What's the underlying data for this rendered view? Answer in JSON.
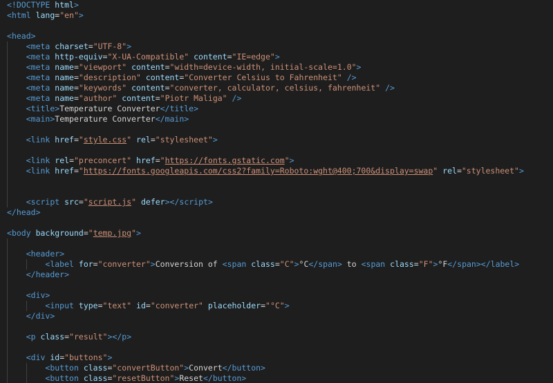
{
  "colors": {
    "background": "#1e1e1e",
    "tag": "#569cd6",
    "attribute": "#9cdcfe",
    "string": "#ce9178",
    "text": "#d4d4d4",
    "punctuation": "#808080"
  },
  "lines": [
    {
      "indent": 0,
      "tokens": [
        [
          "punct",
          "<!"
        ],
        [
          "tag",
          "DOCTYPE"
        ],
        [
          "text",
          " "
        ],
        [
          "attr",
          "html"
        ],
        [
          "punct",
          ">"
        ]
      ]
    },
    {
      "indent": 0,
      "tokens": [
        [
          "punct",
          "<"
        ],
        [
          "tag",
          "html"
        ],
        [
          "text",
          " "
        ],
        [
          "attr",
          "lang"
        ],
        [
          "text",
          "="
        ],
        [
          "str",
          "\"en\""
        ],
        [
          "punct",
          ">"
        ]
      ]
    },
    {
      "indent": 0,
      "tokens": []
    },
    {
      "indent": 0,
      "tokens": [
        [
          "punct",
          "<"
        ],
        [
          "tag",
          "head"
        ],
        [
          "punct",
          ">"
        ]
      ]
    },
    {
      "indent": 1,
      "tokens": [
        [
          "punct",
          "<"
        ],
        [
          "tag",
          "meta"
        ],
        [
          "text",
          " "
        ],
        [
          "attr",
          "charset"
        ],
        [
          "text",
          "="
        ],
        [
          "str",
          "\"UTF-8\""
        ],
        [
          "punct",
          ">"
        ]
      ]
    },
    {
      "indent": 1,
      "tokens": [
        [
          "punct",
          "<"
        ],
        [
          "tag",
          "meta"
        ],
        [
          "text",
          " "
        ],
        [
          "attr",
          "http-equiv"
        ],
        [
          "text",
          "="
        ],
        [
          "str",
          "\"X-UA-Compatible\""
        ],
        [
          "text",
          " "
        ],
        [
          "attr",
          "content"
        ],
        [
          "text",
          "="
        ],
        [
          "str",
          "\"IE=edge\""
        ],
        [
          "punct",
          ">"
        ]
      ]
    },
    {
      "indent": 1,
      "tokens": [
        [
          "punct",
          "<"
        ],
        [
          "tag",
          "meta"
        ],
        [
          "text",
          " "
        ],
        [
          "attr",
          "name"
        ],
        [
          "text",
          "="
        ],
        [
          "str",
          "\"viewport\""
        ],
        [
          "text",
          " "
        ],
        [
          "attr",
          "content"
        ],
        [
          "text",
          "="
        ],
        [
          "str",
          "\"width=device-width, initial-scale=1.0\""
        ],
        [
          "punct",
          ">"
        ]
      ]
    },
    {
      "indent": 1,
      "tokens": [
        [
          "punct",
          "<"
        ],
        [
          "tag",
          "meta"
        ],
        [
          "text",
          " "
        ],
        [
          "attr",
          "name"
        ],
        [
          "text",
          "="
        ],
        [
          "str",
          "\"description\""
        ],
        [
          "text",
          " "
        ],
        [
          "attr",
          "content"
        ],
        [
          "text",
          "="
        ],
        [
          "str",
          "\"Converter Celsius to Fahrenheit\""
        ],
        [
          "text",
          " "
        ],
        [
          "punct",
          "/>"
        ]
      ]
    },
    {
      "indent": 1,
      "tokens": [
        [
          "punct",
          "<"
        ],
        [
          "tag",
          "meta"
        ],
        [
          "text",
          " "
        ],
        [
          "attr",
          "name"
        ],
        [
          "text",
          "="
        ],
        [
          "str",
          "\"keywords\""
        ],
        [
          "text",
          " "
        ],
        [
          "attr",
          "content"
        ],
        [
          "text",
          "="
        ],
        [
          "str",
          "\"converter, calculator, celsius, fahrenheit\""
        ],
        [
          "text",
          " "
        ],
        [
          "punct",
          "/>"
        ]
      ]
    },
    {
      "indent": 1,
      "tokens": [
        [
          "punct",
          "<"
        ],
        [
          "tag",
          "meta"
        ],
        [
          "text",
          " "
        ],
        [
          "attr",
          "name"
        ],
        [
          "text",
          "="
        ],
        [
          "str",
          "\"author\""
        ],
        [
          "text",
          " "
        ],
        [
          "attr",
          "content"
        ],
        [
          "text",
          "="
        ],
        [
          "str",
          "\"Piotr Maliga\""
        ],
        [
          "text",
          " "
        ],
        [
          "punct",
          "/>"
        ]
      ]
    },
    {
      "indent": 1,
      "tokens": [
        [
          "punct",
          "<"
        ],
        [
          "tag",
          "title"
        ],
        [
          "punct",
          ">"
        ],
        [
          "text",
          "Temperature Converter"
        ],
        [
          "punct",
          "</"
        ],
        [
          "tag",
          "title"
        ],
        [
          "punct",
          ">"
        ]
      ]
    },
    {
      "indent": 1,
      "tokens": [
        [
          "punct",
          "<"
        ],
        [
          "tag",
          "main"
        ],
        [
          "punct",
          ">"
        ],
        [
          "text",
          "Temperature Converter"
        ],
        [
          "punct",
          "</"
        ],
        [
          "tag",
          "main"
        ],
        [
          "punct",
          ">"
        ]
      ]
    },
    {
      "indent": 1,
      "tokens": []
    },
    {
      "indent": 1,
      "tokens": [
        [
          "punct",
          "<"
        ],
        [
          "tag",
          "link"
        ],
        [
          "text",
          " "
        ],
        [
          "attr",
          "href"
        ],
        [
          "text",
          "="
        ],
        [
          "str",
          "\""
        ],
        [
          "link",
          "style.css"
        ],
        [
          "str",
          "\""
        ],
        [
          "text",
          " "
        ],
        [
          "attr",
          "rel"
        ],
        [
          "text",
          "="
        ],
        [
          "str",
          "\"stylesheet\""
        ],
        [
          "punct",
          ">"
        ]
      ]
    },
    {
      "indent": 1,
      "tokens": []
    },
    {
      "indent": 1,
      "tokens": [
        [
          "punct",
          "<"
        ],
        [
          "tag",
          "link"
        ],
        [
          "text",
          " "
        ],
        [
          "attr",
          "rel"
        ],
        [
          "text",
          "="
        ],
        [
          "str",
          "\"preconcert\""
        ],
        [
          "text",
          " "
        ],
        [
          "attr",
          "href"
        ],
        [
          "text",
          "="
        ],
        [
          "str",
          "\""
        ],
        [
          "link",
          "https://fonts.gstatic.com"
        ],
        [
          "str",
          "\""
        ],
        [
          "punct",
          ">"
        ]
      ]
    },
    {
      "indent": 1,
      "tokens": [
        [
          "punct",
          "<"
        ],
        [
          "tag",
          "link"
        ],
        [
          "text",
          " "
        ],
        [
          "attr",
          "href"
        ],
        [
          "text",
          "="
        ],
        [
          "str",
          "\""
        ],
        [
          "link",
          "https://fonts.googleapis.com/css2?family=Roboto:wght@400;700&display=swap"
        ],
        [
          "str",
          "\""
        ],
        [
          "text",
          " "
        ],
        [
          "attr",
          "rel"
        ],
        [
          "text",
          "="
        ],
        [
          "str",
          "\"stylesheet\""
        ],
        [
          "punct",
          ">"
        ]
      ]
    },
    {
      "indent": 1,
      "tokens": []
    },
    {
      "indent": 1,
      "tokens": []
    },
    {
      "indent": 1,
      "tokens": [
        [
          "punct",
          "<"
        ],
        [
          "tag",
          "script"
        ],
        [
          "text",
          " "
        ],
        [
          "attr",
          "src"
        ],
        [
          "text",
          "="
        ],
        [
          "str",
          "\""
        ],
        [
          "link",
          "script.js"
        ],
        [
          "str",
          "\""
        ],
        [
          "text",
          " "
        ],
        [
          "attr",
          "defer"
        ],
        [
          "punct",
          ">"
        ],
        [
          "punct",
          "</"
        ],
        [
          "tag",
          "script"
        ],
        [
          "punct",
          ">"
        ]
      ]
    },
    {
      "indent": 0,
      "tokens": [
        [
          "punct",
          "</"
        ],
        [
          "tag",
          "head"
        ],
        [
          "punct",
          ">"
        ]
      ]
    },
    {
      "indent": 0,
      "tokens": []
    },
    {
      "indent": 0,
      "tokens": [
        [
          "punct",
          "<"
        ],
        [
          "tag",
          "body"
        ],
        [
          "text",
          " "
        ],
        [
          "attr",
          "background"
        ],
        [
          "text",
          "="
        ],
        [
          "str",
          "\""
        ],
        [
          "link",
          "temp.jpg"
        ],
        [
          "str",
          "\""
        ],
        [
          "punct",
          ">"
        ]
      ]
    },
    {
      "indent": 1,
      "tokens": []
    },
    {
      "indent": 1,
      "tokens": [
        [
          "punct",
          "<"
        ],
        [
          "tag",
          "header"
        ],
        [
          "punct",
          ">"
        ]
      ]
    },
    {
      "indent": 2,
      "tokens": [
        [
          "punct",
          "<"
        ],
        [
          "tag",
          "label"
        ],
        [
          "text",
          " "
        ],
        [
          "attr",
          "for"
        ],
        [
          "text",
          "="
        ],
        [
          "str",
          "\"converter\""
        ],
        [
          "punct",
          ">"
        ],
        [
          "text",
          "Conversion of "
        ],
        [
          "punct",
          "<"
        ],
        [
          "tag",
          "span"
        ],
        [
          "text",
          " "
        ],
        [
          "attr",
          "class"
        ],
        [
          "text",
          "="
        ],
        [
          "str",
          "\"C\""
        ],
        [
          "punct",
          ">"
        ],
        [
          "text",
          "°C"
        ],
        [
          "punct",
          "</"
        ],
        [
          "tag",
          "span"
        ],
        [
          "punct",
          ">"
        ],
        [
          "text",
          " to "
        ],
        [
          "punct",
          "<"
        ],
        [
          "tag",
          "span"
        ],
        [
          "text",
          " "
        ],
        [
          "attr",
          "class"
        ],
        [
          "text",
          "="
        ],
        [
          "str",
          "\"F\""
        ],
        [
          "punct",
          ">"
        ],
        [
          "text",
          "°F"
        ],
        [
          "punct",
          "</"
        ],
        [
          "tag",
          "span"
        ],
        [
          "punct",
          ">"
        ],
        [
          "punct",
          "</"
        ],
        [
          "tag",
          "label"
        ],
        [
          "punct",
          ">"
        ]
      ]
    },
    {
      "indent": 1,
      "tokens": [
        [
          "punct",
          "</"
        ],
        [
          "tag",
          "header"
        ],
        [
          "punct",
          ">"
        ]
      ]
    },
    {
      "indent": 1,
      "tokens": []
    },
    {
      "indent": 1,
      "tokens": [
        [
          "punct",
          "<"
        ],
        [
          "tag",
          "div"
        ],
        [
          "punct",
          ">"
        ]
      ]
    },
    {
      "indent": 2,
      "tokens": [
        [
          "punct",
          "<"
        ],
        [
          "tag",
          "input"
        ],
        [
          "text",
          " "
        ],
        [
          "attr",
          "type"
        ],
        [
          "text",
          "="
        ],
        [
          "str",
          "\"text\""
        ],
        [
          "text",
          " "
        ],
        [
          "attr",
          "id"
        ],
        [
          "text",
          "="
        ],
        [
          "str",
          "\"converter\""
        ],
        [
          "text",
          " "
        ],
        [
          "attr",
          "placeholder"
        ],
        [
          "text",
          "="
        ],
        [
          "str",
          "\"°C\""
        ],
        [
          "punct",
          ">"
        ]
      ]
    },
    {
      "indent": 1,
      "tokens": [
        [
          "punct",
          "</"
        ],
        [
          "tag",
          "div"
        ],
        [
          "punct",
          ">"
        ]
      ]
    },
    {
      "indent": 1,
      "tokens": []
    },
    {
      "indent": 1,
      "tokens": [
        [
          "punct",
          "<"
        ],
        [
          "tag",
          "p"
        ],
        [
          "text",
          " "
        ],
        [
          "attr",
          "class"
        ],
        [
          "text",
          "="
        ],
        [
          "str",
          "\"result\""
        ],
        [
          "punct",
          ">"
        ],
        [
          "punct",
          "</"
        ],
        [
          "tag",
          "p"
        ],
        [
          "punct",
          ">"
        ]
      ]
    },
    {
      "indent": 1,
      "tokens": []
    },
    {
      "indent": 1,
      "tokens": [
        [
          "punct",
          "<"
        ],
        [
          "tag",
          "div"
        ],
        [
          "text",
          " "
        ],
        [
          "attr",
          "id"
        ],
        [
          "text",
          "="
        ],
        [
          "str",
          "\"buttons\""
        ],
        [
          "punct",
          ">"
        ]
      ]
    },
    {
      "indent": 2,
      "tokens": [
        [
          "punct",
          "<"
        ],
        [
          "tag",
          "button"
        ],
        [
          "text",
          " "
        ],
        [
          "attr",
          "class"
        ],
        [
          "text",
          "="
        ],
        [
          "str",
          "\"convertButton\""
        ],
        [
          "punct",
          ">"
        ],
        [
          "text",
          "Convert"
        ],
        [
          "punct",
          "</"
        ],
        [
          "tag",
          "button"
        ],
        [
          "punct",
          ">"
        ]
      ]
    },
    {
      "indent": 2,
      "tokens": [
        [
          "punct",
          "<"
        ],
        [
          "tag",
          "button"
        ],
        [
          "text",
          " "
        ],
        [
          "attr",
          "class"
        ],
        [
          "text",
          "="
        ],
        [
          "str",
          "\"resetButton\""
        ],
        [
          "punct",
          ">"
        ],
        [
          "text",
          "Reset"
        ],
        [
          "punct",
          "</"
        ],
        [
          "tag",
          "button"
        ],
        [
          "punct",
          ">"
        ]
      ]
    }
  ]
}
